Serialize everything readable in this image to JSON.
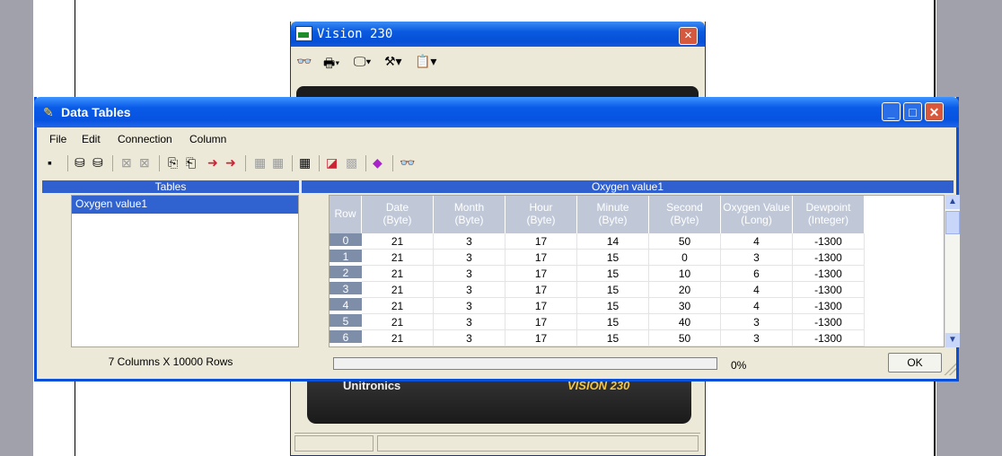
{
  "vision_window": {
    "title": "Vision 230",
    "close_label": "✕",
    "toolbar_icons": [
      "binoculars-icon",
      "settings-icon",
      "monitor-icon",
      "tools-icon",
      "properties-icon"
    ],
    "brand_left": "Unitronics",
    "brand_right": "VISION 230"
  },
  "data_tables_window": {
    "title": "Data Tables",
    "min_label": "_",
    "max_label": "□",
    "close_label": "✕",
    "menu": [
      "File",
      "Edit",
      "Connection",
      "Column"
    ],
    "tables_header": "Tables",
    "tables_list": [
      "Oxygen value1"
    ],
    "grid_header": "Oxygen value1",
    "columns": [
      {
        "l1": "Row",
        "l2": ""
      },
      {
        "l1": "Date",
        "l2": "(Byte)"
      },
      {
        "l1": "Month",
        "l2": "(Byte)"
      },
      {
        "l1": "Hour",
        "l2": "(Byte)"
      },
      {
        "l1": "Minute",
        "l2": "(Byte)"
      },
      {
        "l1": "Second",
        "l2": "(Byte)"
      },
      {
        "l1": "Oxygen Value",
        "l2": "(Long)"
      },
      {
        "l1": "Dewpoint",
        "l2": "(Integer)"
      }
    ],
    "rows": [
      [
        "0",
        "21",
        "3",
        "17",
        "14",
        "50",
        "4",
        "-1300"
      ],
      [
        "1",
        "21",
        "3",
        "17",
        "15",
        "0",
        "3",
        "-1300"
      ],
      [
        "2",
        "21",
        "3",
        "17",
        "15",
        "10",
        "6",
        "-1300"
      ],
      [
        "3",
        "21",
        "3",
        "17",
        "15",
        "20",
        "4",
        "-1300"
      ],
      [
        "4",
        "21",
        "3",
        "17",
        "15",
        "30",
        "4",
        "-1300"
      ],
      [
        "5",
        "21",
        "3",
        "17",
        "15",
        "40",
        "3",
        "-1300"
      ],
      [
        "6",
        "21",
        "3",
        "17",
        "15",
        "50",
        "3",
        "-1300"
      ]
    ],
    "status_text": "7 Columns X 10000 Rows",
    "progress_percent": 0,
    "progress_label": "0%",
    "ok_label": "OK"
  }
}
